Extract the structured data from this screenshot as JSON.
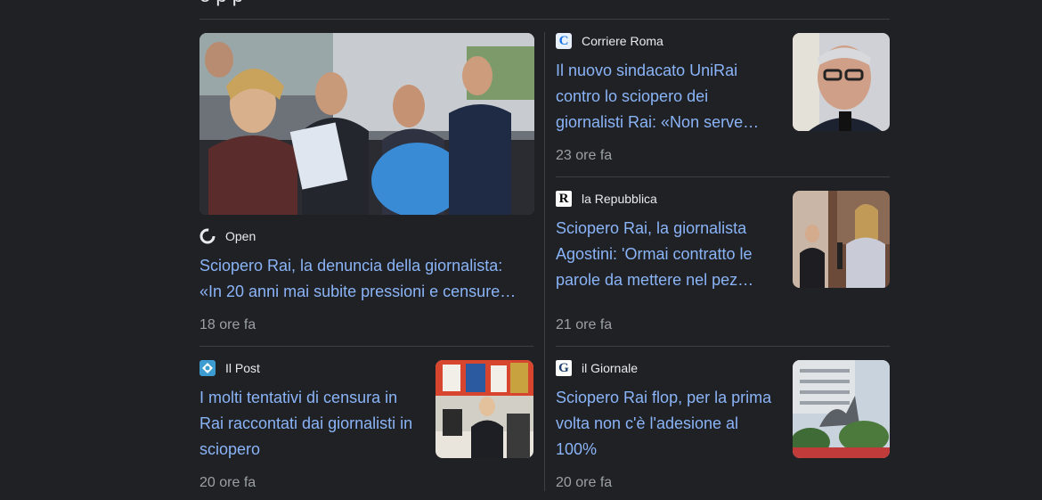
{
  "header": {
    "partial_title": "e p p"
  },
  "articles": [
    {
      "source": "Open",
      "headline": "Sciopero Rai, la denuncia della giornalista: «In 20 anni mai subite pressioni e censure…",
      "time": "18 ore fa",
      "logo_icon": "open-circle-icon"
    },
    {
      "source": "Corriere Roma",
      "headline": "Il nuovo sindacato UniRai contro lo sciopero dei giornalisti Rai: «Non serve…",
      "time": "23 ore fa",
      "logo_icon": "corriere-c-icon"
    },
    {
      "source": "la Repubblica",
      "headline": "Sciopero Rai, la giornalista Agostini: 'Ormai contratto le parole da mettere nel pez…",
      "time": "21 ore fa",
      "logo_icon": "repubblica-r-icon"
    },
    {
      "source": "Il Post",
      "headline": "I molti tentativi di censura in Rai raccontati dai giornalisti in sciopero",
      "time": "20 ore fa",
      "logo_icon": "ilpost-icon"
    },
    {
      "source": "il Giornale",
      "headline": "Sciopero Rai flop, per la prima volta non c'è l'adesione al 100%",
      "time": "20 ore fa",
      "logo_icon": "ilgiornale-g-icon"
    }
  ],
  "colors": {
    "background": "#202124",
    "link": "#8ab4f8",
    "meta": "#9aa0a6",
    "divider": "#3c4043"
  }
}
